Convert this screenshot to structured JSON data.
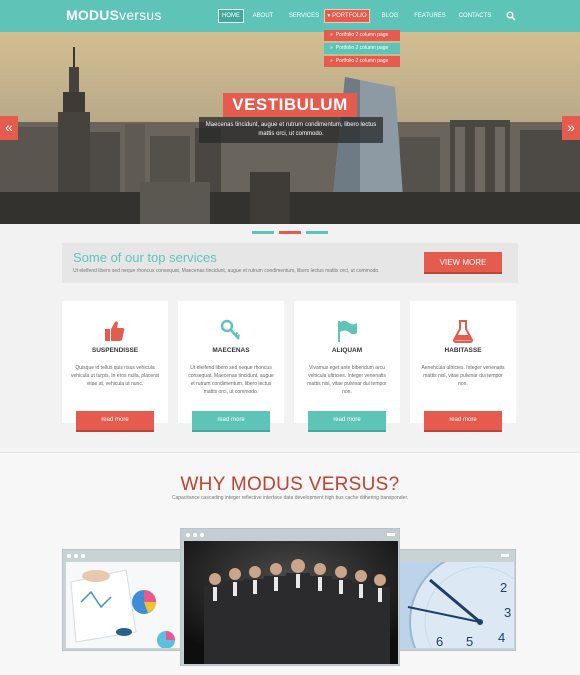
{
  "header": {
    "logo_bold": "MODUS",
    "logo_thin": "versus",
    "nav": [
      "HOME",
      "ABOUT",
      "SERVICES",
      "PORTFOLIO",
      "BLOG",
      "FEATURES",
      "CONTACTS"
    ],
    "dropdown": [
      "Portfolio 2 column page",
      "Portfolio 2 column page",
      "Portfolio 2 column page"
    ]
  },
  "hero": {
    "title": "VESTIBULUM",
    "text": "Maecenas tincidunt, augue et rutrum condimentum, libero lectus mattis orci, ut commodo.",
    "prev": "«",
    "next": "»"
  },
  "services": {
    "title": "Some of our top services",
    "subtitle": "Ut eleifend libero sed neque rhoncus consequat, Maecenas tincidunt, augue et rutrum condimentum, libero lectus mattis orci, ut commodo.",
    "button": "VIEW MORE"
  },
  "cards": [
    {
      "title": "SUSPENDISSE",
      "text": "Quisque id tellus quis risus vehicula vehicula ut turpis. In eros nulla, placerat vitae at, vehicula ut nunc.",
      "button": "read more"
    },
    {
      "title": "MAECENAS",
      "text": "Ut eleifend libero sed neque rhoncus consequat. Maecenas tincidunt, augue et rutrum condimentum, libero lectus mattis orci, ut commodo.",
      "button": "read more"
    },
    {
      "title": "ALIQUAM",
      "text": "Vivamus eget ante bibendum arcu vehicula ultricies. Integer venenatis mattis nisl, vitae pulvinar dui tempor non.",
      "button": "read more"
    },
    {
      "title": "HABITASSE",
      "text": "Aenehcula ultricies. Integer venenatis mattis nisl, vitae pulvinar dui tempor non.",
      "button": "read more"
    }
  ],
  "why": {
    "title": "WHY MODUS VERSUS?",
    "subtitle": "Capacitance cascading integer reflective interface data development high bus cache dithering transponder."
  },
  "colors": {
    "teal": "#5ec4b8",
    "red": "#e55b4d"
  },
  "icons": [
    "thumbs-up-icon",
    "key-icon",
    "flag-icon",
    "flask-icon",
    "search-icon",
    "chevron-left-icon",
    "chevron-right-icon"
  ]
}
